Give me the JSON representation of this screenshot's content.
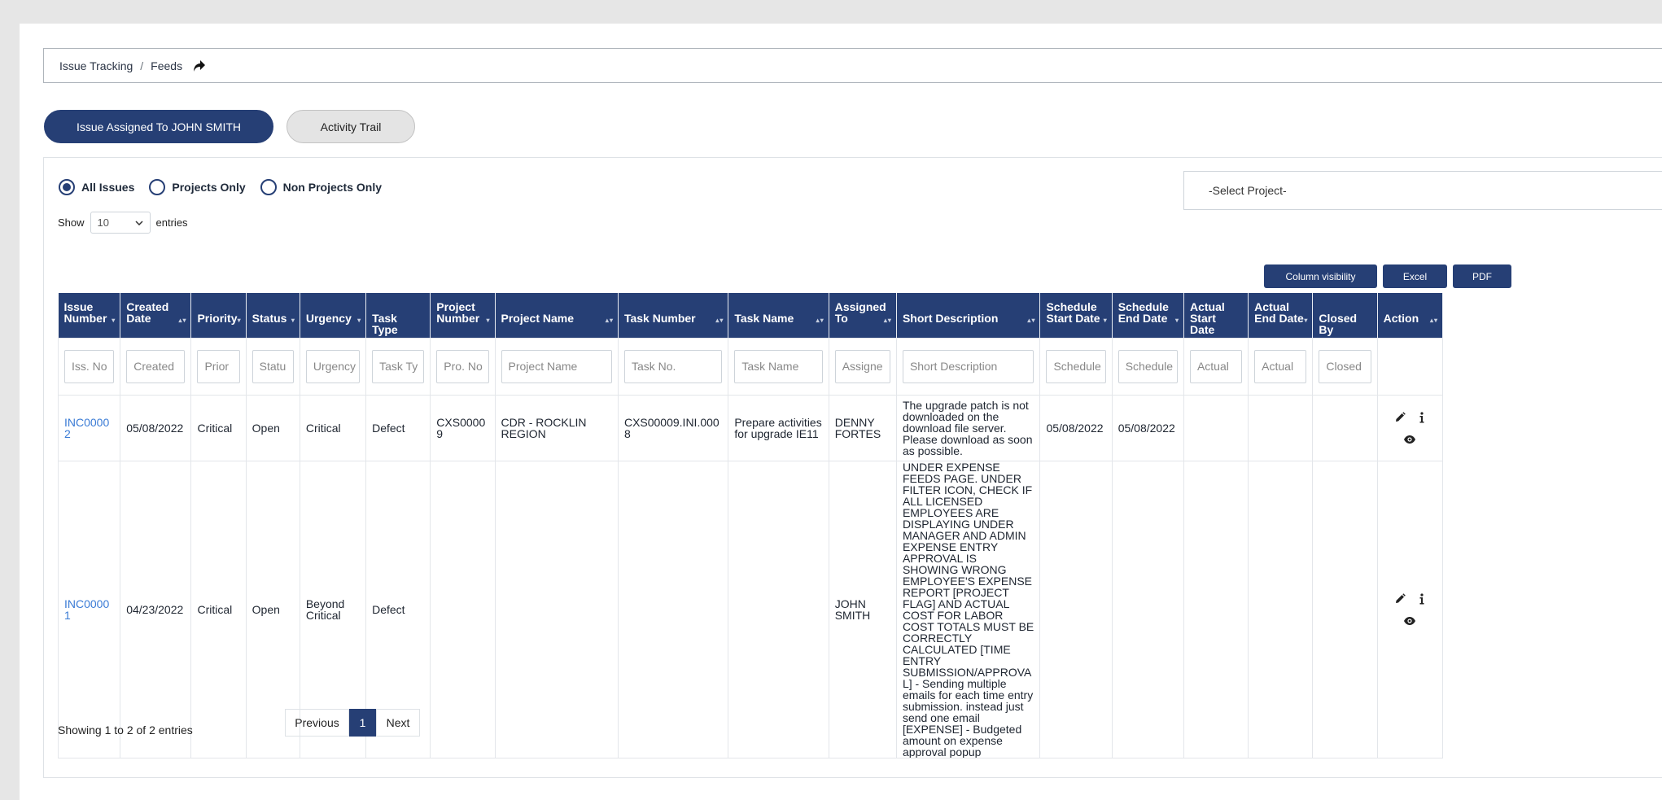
{
  "breadcrumb": {
    "root": "Issue Tracking",
    "separator": "/",
    "current": "Feeds"
  },
  "tabs": [
    {
      "label": "Issue Assigned To JOHN SMITH",
      "active": true
    },
    {
      "label": "Activity Trail",
      "active": false
    }
  ],
  "filters": {
    "radios": [
      {
        "label": "All Issues",
        "checked": true
      },
      {
        "label": "Projects Only",
        "checked": false
      },
      {
        "label": "Non Projects Only",
        "checked": false
      }
    ],
    "project_select": "-Select Project-"
  },
  "length": {
    "show": "Show",
    "value": "10",
    "entries": "entries"
  },
  "toolbar": {
    "column_visibility": "Column visibility",
    "excel": "Excel",
    "pdf": "PDF"
  },
  "columns": [
    {
      "label": "Issue Number",
      "placeholder": "Iss. No"
    },
    {
      "label": "Created Date",
      "placeholder": "Created"
    },
    {
      "label": "Priority",
      "placeholder": "Prior"
    },
    {
      "label": "Status",
      "placeholder": "Statu"
    },
    {
      "label": "Urgency",
      "placeholder": "Urgency"
    },
    {
      "label": "Task Type",
      "placeholder": "Task Ty"
    },
    {
      "label": "Project Number",
      "placeholder": "Pro. No"
    },
    {
      "label": "Project Name",
      "placeholder": "Project Name"
    },
    {
      "label": "Task Number",
      "placeholder": "Task No."
    },
    {
      "label": "Task Name",
      "placeholder": "Task Name"
    },
    {
      "label": "Assigned To",
      "placeholder": "Assigne"
    },
    {
      "label": "Short Description",
      "placeholder": "Short Description"
    },
    {
      "label": "Schedule Start Date",
      "placeholder": "Schedule"
    },
    {
      "label": "Schedule End Date",
      "placeholder": "Schedule"
    },
    {
      "label": "Actual Start Date",
      "placeholder": "Actual"
    },
    {
      "label": "Actual End Date",
      "placeholder": "Actual"
    },
    {
      "label": "Closed By",
      "placeholder": "Closed"
    },
    {
      "label": "Action",
      "placeholder": ""
    }
  ],
  "rows": [
    {
      "issue": "INC00002",
      "created": "05/08/2022",
      "priority": "Critical",
      "status": "Open",
      "urgency": "Critical",
      "task_type": "Defect",
      "project_number": "CXS00009",
      "project_name": "CDR - ROCKLIN REGION",
      "task_number": "CXS00009.INI.0008",
      "task_name": "Prepare activities for upgrade IE11",
      "assigned_to": "DENNY FORTES",
      "short_description": "The upgrade patch is not downloaded on the download file server. Please download as soon as possible.",
      "schedule_start": "05/08/2022",
      "schedule_end": "05/08/2022",
      "actual_start": "",
      "actual_end": "",
      "closed_by": ""
    },
    {
      "issue": "INC00001",
      "created": "04/23/2022",
      "priority": "Critical",
      "status": "Open",
      "urgency": "Beyond Critical",
      "task_type": "Defect",
      "project_number": "",
      "project_name": "",
      "task_number": "",
      "task_name": "",
      "assigned_to": "JOHN SMITH",
      "short_description": "UNDER EXPENSE FEEDS PAGE. UNDER FILTER ICON, CHECK IF ALL LICENSED EMPLOYEES ARE DISPLAYING UNDER MANAGER AND ADMIN EXPENSE ENTRY APPROVAL IS SHOWING WRONG EMPLOYEE'S EXPENSE REPORT [PROJECT FLAG] AND ACTUAL COST FOR LABOR COST TOTALS MUST BE CORRECTLY CALCULATED [TIME ENTRY SUBMISSION/APPROVAL] - Sending multiple emails for each time entry submission. instead just send one email [EXPENSE] - Budgeted amount on expense approval popup",
      "schedule_start": "",
      "schedule_end": "",
      "actual_start": "",
      "actual_end": "",
      "closed_by": ""
    }
  ],
  "footer": {
    "info": "Showing 1 to 2 of 2 entries",
    "previous": "Previous",
    "page": "1",
    "next": "Next"
  },
  "colors": {
    "primary": "#263f75",
    "link": "#3a7bd5"
  }
}
